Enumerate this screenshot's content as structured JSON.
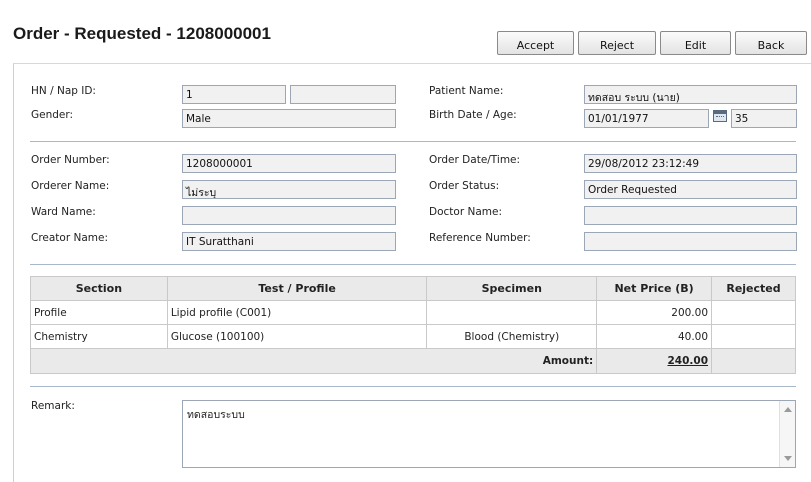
{
  "page": {
    "title": "Order - Requested - 1208000001"
  },
  "toolbar": {
    "accept": "Accept",
    "reject": "Reject",
    "edit": "Edit",
    "back": "Back"
  },
  "patient": {
    "hn_label": "HN / Nap ID:",
    "hn_value": "1",
    "nap_value": "",
    "name_label": "Patient Name:",
    "name_value": "ทดสอบ ระบบ (นาย)",
    "gender_label": "Gender:",
    "gender_value": "Male",
    "birth_label": "Birth Date / Age:",
    "birth_value": "01/01/1977",
    "age_value": "35"
  },
  "order": {
    "number_label": "Order Number:",
    "number_value": "1208000001",
    "datetime_label": "Order Date/Time:",
    "datetime_value": "29/08/2012 23:12:49",
    "orderer_label": "Orderer Name:",
    "orderer_value": "ไม่ระบุ",
    "status_label": "Order Status:",
    "status_value": "Order Requested",
    "ward_label": "Ward Name:",
    "ward_value": "",
    "doctor_label": "Doctor Name:",
    "doctor_value": "",
    "creator_label": "Creator Name:",
    "creator_value": "IT Suratthani",
    "reference_label": "Reference Number:",
    "reference_value": ""
  },
  "table": {
    "headers": {
      "section": "Section",
      "test": "Test / Profile",
      "specimen": "Specimen",
      "net_price": "Net Price (B)",
      "rejected": "Rejected"
    },
    "rows": [
      {
        "section": "Profile",
        "test": "Lipid profile (C001)",
        "specimen": "",
        "net_price": "200.00",
        "rejected": ""
      },
      {
        "section": "Chemistry",
        "test": "Glucose (100100)",
        "specimen": "Blood (Chemistry)",
        "net_price": "40.00",
        "rejected": ""
      }
    ],
    "amount_label": "Amount:",
    "amount_value": "240.00"
  },
  "remark": {
    "label": "Remark:",
    "value": "ทดสอบระบบ"
  }
}
